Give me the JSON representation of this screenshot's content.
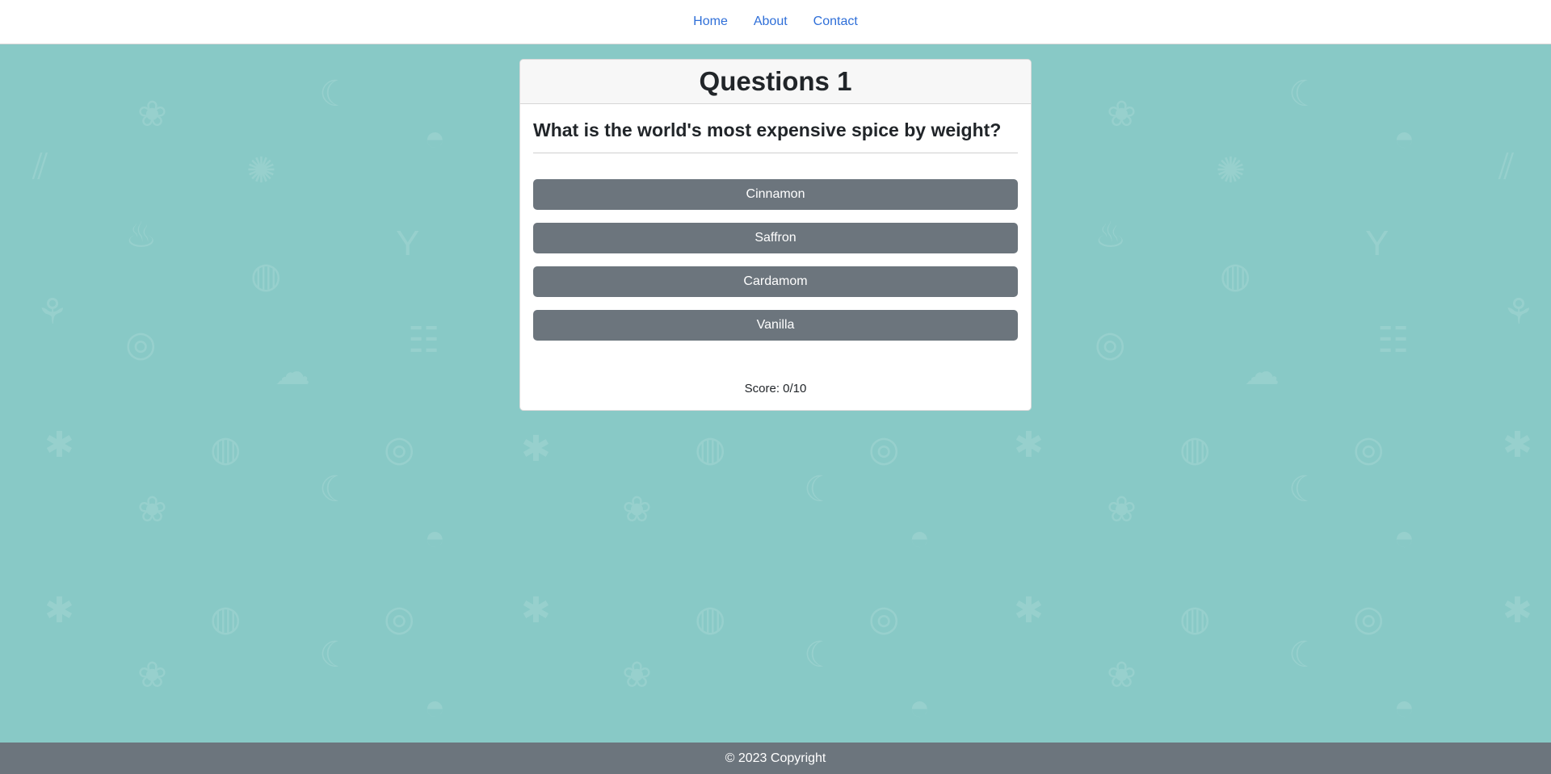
{
  "nav": {
    "items": [
      {
        "label": "Home"
      },
      {
        "label": "About"
      },
      {
        "label": "Contact"
      }
    ]
  },
  "quiz": {
    "header": "Questions 1",
    "question": "What is the world's most expensive spice by weight?",
    "answers": [
      {
        "label": "Cinnamon"
      },
      {
        "label": "Saffron"
      },
      {
        "label": "Cardamom"
      },
      {
        "label": "Vanilla"
      }
    ],
    "score": "Score: 0/10"
  },
  "footer": {
    "copyright": "© 2023 Copyright"
  },
  "colors": {
    "background": "#88c9c6",
    "accent_link": "#2f6fd8",
    "button": "#6c757d",
    "footer": "#6c757d"
  },
  "background_icons": [
    "banana-icon",
    "grapes-icon",
    "pie-icon",
    "celery-icon",
    "citrus-icon",
    "chicken-icon",
    "cocktail-icon",
    "melon-icon",
    "cherry-icon",
    "sushi-icon",
    "grill-icon",
    "broccoli-icon",
    "pineapple-icon",
    "watermelon-icon",
    "donut-icon"
  ]
}
